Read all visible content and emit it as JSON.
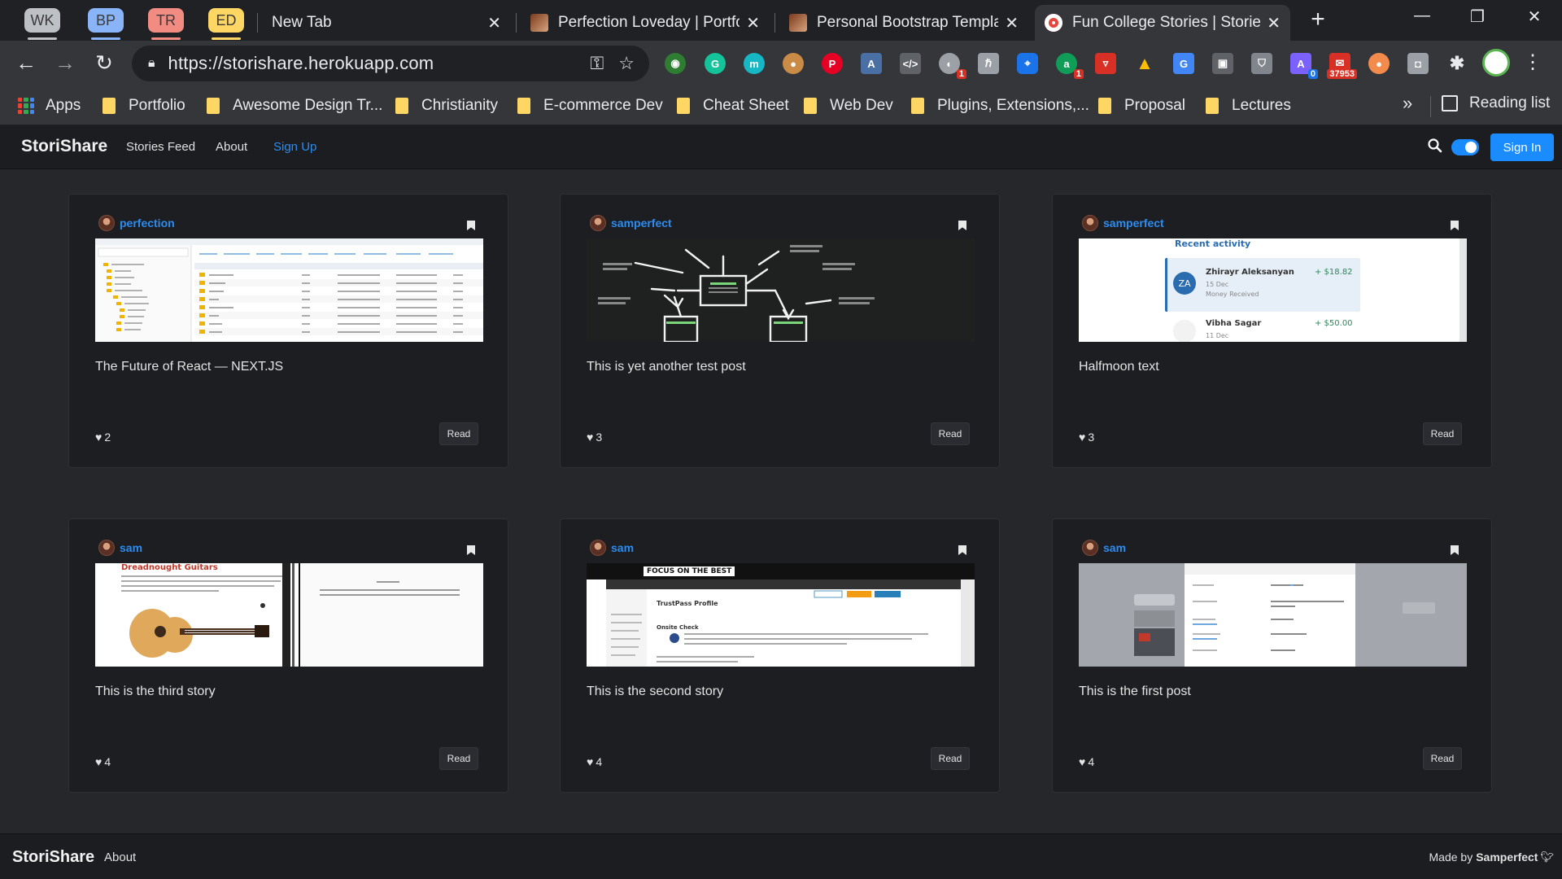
{
  "browser": {
    "tab_groups": [
      {
        "label": "WK",
        "color": "#bdc1c6"
      },
      {
        "label": "BP",
        "color": "#8ab4f8"
      },
      {
        "label": "TR",
        "color": "#f28b82"
      },
      {
        "label": "ED",
        "color": "#fdd663"
      }
    ],
    "tabs": [
      {
        "title": "New Tab"
      },
      {
        "title": "Perfection Loveday | Portfolio"
      },
      {
        "title": "Personal Bootstrap Template"
      },
      {
        "title": "Fun College Stories | Stories"
      }
    ],
    "url": "https://storishare.herokuapp.com",
    "extension_badges": {
      "badge1": "1",
      "badge2": "1",
      "badge3": "0",
      "badge4": "37953"
    },
    "bookmarks": [
      {
        "label": "Apps"
      },
      {
        "label": "Portfolio"
      },
      {
        "label": "Awesome Design Tr..."
      },
      {
        "label": "Christianity"
      },
      {
        "label": "E-commerce Dev"
      },
      {
        "label": "Cheat Sheet"
      },
      {
        "label": "Web Dev"
      },
      {
        "label": "Plugins, Extensions,..."
      },
      {
        "label": "Proposal"
      },
      {
        "label": "Lectures"
      }
    ],
    "more_label": "»",
    "reading_list": "Reading list"
  },
  "site": {
    "brand": "StoriShare",
    "nav": {
      "feed": "Stories Feed",
      "about": "About",
      "signup": "Sign Up"
    },
    "signin": "Sign In"
  },
  "cards": [
    {
      "author": "perfection",
      "title": "The Future of React — NEXT.JS",
      "likes": "2",
      "read": "Read"
    },
    {
      "author": "samperfect",
      "title": "This is yet another test post",
      "likes": "3",
      "read": "Read"
    },
    {
      "author": "samperfect",
      "title": "Halfmoon text",
      "likes": "3",
      "read": "Read"
    },
    {
      "author": "sam",
      "title": "This is the third story",
      "likes": "4",
      "read": "Read"
    },
    {
      "author": "sam",
      "title": "This is the second story",
      "likes": "4",
      "read": "Read"
    },
    {
      "author": "sam",
      "title": "This is the first post",
      "likes": "4",
      "read": "Read"
    }
  ],
  "thumbs": {
    "fin": {
      "heading": "Recent activity",
      "initials": "ZA",
      "name1": "Zhirayr Aleksanyan",
      "date1": "15 Dec",
      "desc1": "Money Received",
      "amount1": "+ $18.82",
      "name2": "Vibha Sagar",
      "date2": "11 Dec",
      "amount2": "+ $50.00"
    },
    "guitar": {
      "heading": "Dreadnought Guitars"
    },
    "site": {
      "banner": "FOCUS ON THE BEST",
      "profile": "TrustPass Profile",
      "check": "Onsite Check"
    }
  },
  "footer": {
    "brand": "StoriShare",
    "about": "About",
    "made_by": "Made by",
    "author": "Samperfect"
  }
}
